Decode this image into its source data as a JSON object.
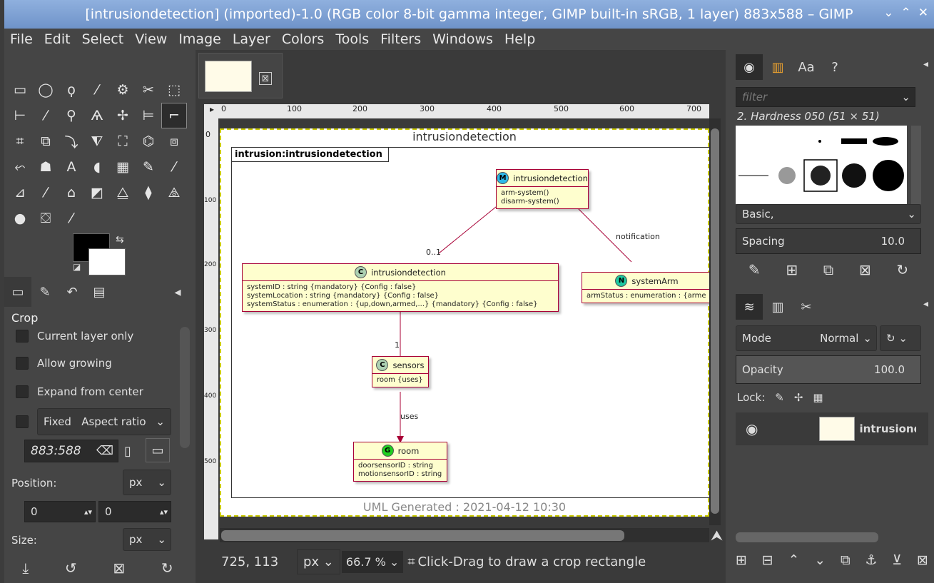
{
  "window": {
    "title": "[intrusiondetection] (imported)-1.0 (RGB color 8-bit gamma integer, GIMP built-in sRGB, 1 layer) 883x588 – GIMP",
    "controls": [
      "⌄",
      "⌃",
      "✕"
    ]
  },
  "menu": [
    "File",
    "Edit",
    "Select",
    "View",
    "Image",
    "Layer",
    "Colors",
    "Tools",
    "Filters",
    "Windows",
    "Help"
  ],
  "tools": [
    "▭",
    "◯",
    "ϙ",
    "⁄",
    "⚙",
    "✂",
    "⬚",
    "⊢",
    "⁄",
    "⚲",
    "Ѧ",
    "✢",
    "⊨",
    "⌐",
    "⌗",
    "⧉",
    "⤵",
    "⧨",
    "⛶",
    "⌬",
    "⧈",
    "⬿",
    "☗",
    "A",
    "◖",
    "▦",
    "✎",
    "⁄",
    "⊿",
    "⁄",
    "⌂",
    "◩",
    "⧋",
    "⧫",
    "⧌",
    "●",
    "⛋",
    "⁄"
  ],
  "tool_options": {
    "title": "Crop",
    "current_layer_only": "Current layer only",
    "allow_growing": "Allow growing",
    "expand_from_center": "Expand from center",
    "fixed": "Fixed",
    "aspect_ratio": "Aspect ratio",
    "ratio_value": "883:588",
    "position_label": "Position:",
    "position_unit": "px",
    "pos_x": "0",
    "pos_y": "0",
    "size_label": "Size:",
    "size_unit": "px"
  },
  "image_tab": {
    "close": "⊠"
  },
  "diagram": {
    "title": "intrusiondetection",
    "frame_label": "intrusion:intrusiondetection",
    "module": {
      "badge": "M",
      "name": "intrusiondetection",
      "ops": [
        "arm-system()",
        "disarm-system()"
      ]
    },
    "cls": {
      "badge": "C",
      "name": "intrusiondetection",
      "attrs": [
        "systemID : string   {mandatory} {Config : false}",
        "systemLocation : string   {mandatory} {Config : false}",
        "systemStatus : enumeration : {up,down,armed,...}   {mandatory} {Config : false}"
      ]
    },
    "notif": {
      "badge": "N",
      "name": "systemArm",
      "attrs": [
        "armStatus : enumeration : {arme"
      ]
    },
    "sensors": {
      "badge": "C",
      "name": "sensors",
      "attrs": [
        "room {uses}"
      ]
    },
    "room": {
      "badge": "G",
      "name": "room",
      "attrs": [
        "doorsensorID : string",
        "motionsensorID : string"
      ]
    },
    "edge_mult1": "0..1",
    "edge_notification": "notification",
    "edge_mult2": "1",
    "edge_uses": "uses",
    "generated": "UML Generated : 2021-04-12 10:30"
  },
  "ruler_h": [
    "0",
    "100",
    "200",
    "300",
    "400",
    "500",
    "600",
    "700"
  ],
  "ruler_v": [
    "0",
    "100",
    "200",
    "300",
    "400",
    "500"
  ],
  "status": {
    "coords": "725, 113",
    "unit": "px",
    "zoom": "66.7 %",
    "message": "Click-Drag to draw a crop rectangle"
  },
  "brushes": {
    "filter_placeholder": "filter",
    "selected": "2. Hardness 050 (51 × 51)",
    "tag": "Basic,",
    "spacing_label": "Spacing",
    "spacing_value": "10.0"
  },
  "layers": {
    "mode_label": "Mode",
    "mode_value": "Normal",
    "opacity_label": "Opacity",
    "opacity_value": "100.0",
    "lock_label": "Lock:",
    "layer_name": "intrusiondete"
  }
}
